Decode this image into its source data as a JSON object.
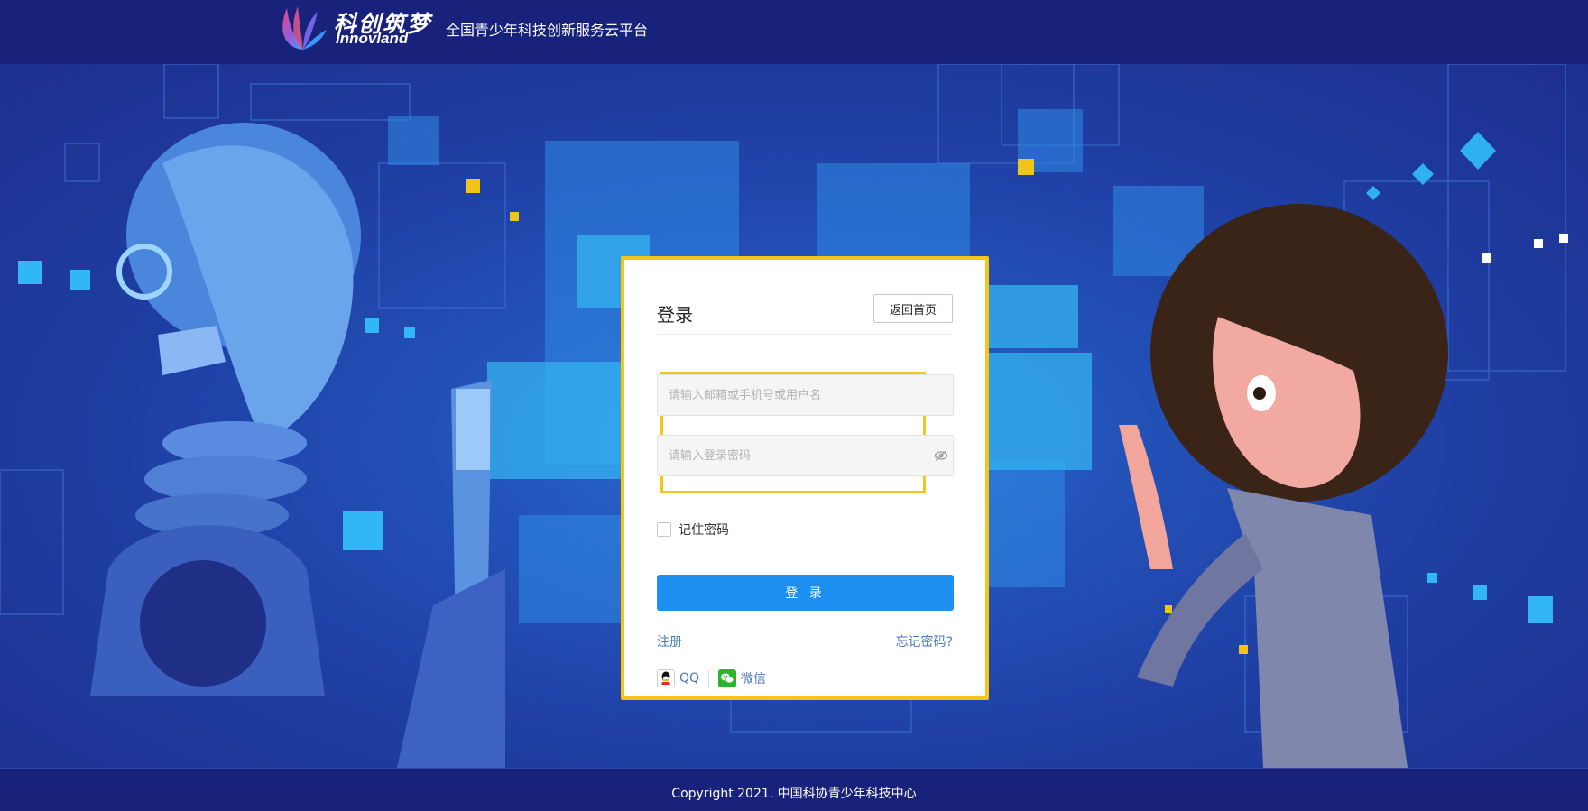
{
  "header": {
    "logo_cn": "科创筑梦",
    "logo_en": "Innovland",
    "platform_title": "全国青少年科技创新服务云平台"
  },
  "login": {
    "title": "登录",
    "back_home_label": "返回首页",
    "username_placeholder": "请输入邮箱或手机号或用户名",
    "password_placeholder": "请输入登录密码",
    "remember_label": "记住密码",
    "login_button_label": "登 录",
    "register_label": "注册",
    "forgot_label": "忘记密码?",
    "social": [
      {
        "label": "QQ",
        "icon": "qq-icon"
      },
      {
        "label": "微信",
        "icon": "wechat-icon"
      }
    ]
  },
  "footer": {
    "copyright": "Copyright 2021. 中国科协青少年科技中心"
  },
  "colors": {
    "header_bg": "#19227a",
    "accent_blue": "#1d8ff1",
    "highlight_yellow": "#f6c518",
    "link_blue": "#4a78b8"
  }
}
